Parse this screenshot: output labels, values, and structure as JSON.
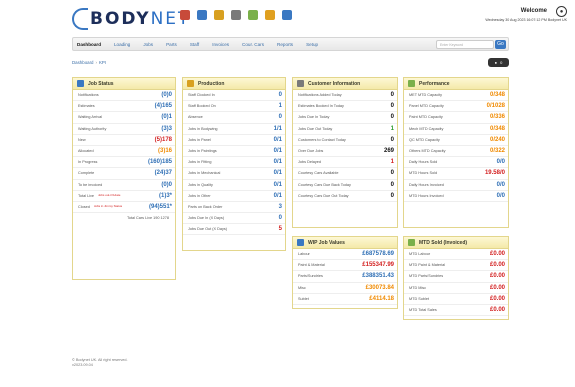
{
  "header": {
    "logo_main": "BODY",
    "logo_accent": "NET",
    "welcome": "Welcome",
    "datetime": "Wednesday 30 Aug 2023 16:07:12 PM  Bodynet UK",
    "icons": [
      "cars-icon",
      "calculator-icon",
      "calendar-icon",
      "tools-icon",
      "paint-icon",
      "star-icon",
      "settings-icon"
    ],
    "icon_colors": [
      "#c84a3a",
      "#3a78c2",
      "#d8a020",
      "#7a7a7a",
      "#7ab04a",
      "#e0a020",
      "#3a78c2"
    ]
  },
  "nav": {
    "items": [
      "Dashboard",
      "Loading",
      "Jobs",
      "Parts",
      "Staff",
      "Invoices",
      "Cour. Cars",
      "Reports",
      "Setup"
    ],
    "search_placeholder": "Enter Keyword",
    "search_btn": "Go"
  },
  "breadcrumb": {
    "home": "Dashboard",
    "current": "KPI",
    "badge": "0"
  },
  "job_status": {
    "title": "Job Status",
    "rows": [
      {
        "label": "Notifications",
        "value": "(0)0",
        "color": "blue"
      },
      {
        "label": "Estimates",
        "value": "(4)165",
        "color": "blue"
      },
      {
        "label": "Waiting Arrival",
        "value": "(0)1",
        "color": "blue"
      },
      {
        "label": "Waiting Authority",
        "value": "(3)3",
        "color": "blue"
      },
      {
        "label": "New",
        "value": "(5)178",
        "color": "red"
      },
      {
        "label": "Allocated",
        "value": "(3)16",
        "color": "orange"
      },
      {
        "label": "In Progress",
        "value": "(160)185",
        "color": "blue"
      },
      {
        "label": "Complete",
        "value": "(24)37",
        "color": "blue"
      },
      {
        "label": "To be invoiced",
        "value": "(0)0",
        "color": "blue"
      },
      {
        "label": "Total Live",
        "note": "Jobs out-Of-date",
        "value": "(1)3*",
        "color": "blue"
      },
      {
        "label": "Closed",
        "note": "Jobs in Jimmy Status",
        "value": "(94)551*",
        "color": "blue"
      }
    ],
    "total_line": "Total Cars Live 190 1278"
  },
  "production": {
    "title": "Production",
    "rows": [
      {
        "label": "Staff Clocked In",
        "value": "0",
        "color": "blue"
      },
      {
        "label": "Staff Booked On",
        "value": "1",
        "color": "blue"
      },
      {
        "label": "Absence",
        "value": "0",
        "color": "blue"
      },
      {
        "label": "Jobs in Bodywing",
        "value": "1/1",
        "color": "blue"
      },
      {
        "label": "Jobs in Panel",
        "value": "0/1",
        "color": "blue"
      },
      {
        "label": "Jobs in Paintings",
        "value": "0/1",
        "color": "blue"
      },
      {
        "label": "Jobs in Fitting",
        "value": "0/1",
        "color": "blue"
      },
      {
        "label": "Jobs in Mechanical",
        "value": "0/1",
        "color": "blue"
      },
      {
        "label": "Jobs in Quality",
        "value": "0/1",
        "color": "blue"
      },
      {
        "label": "Jobs in Other",
        "value": "0/1",
        "color": "blue"
      },
      {
        "label": "Parts on Back Order",
        "value": "3",
        "color": "blue"
      },
      {
        "label": "Jobs Due In (X Days)",
        "value": "0",
        "color": "blue"
      },
      {
        "label": "Jobs Due Out (X Days)",
        "value": "5",
        "color": "red"
      }
    ]
  },
  "customer": {
    "title": "Customer Information",
    "rows": [
      {
        "label": "Notifications Added Today",
        "value": "0",
        "color": "dark"
      },
      {
        "label": "Estimates Booked In Today",
        "value": "0",
        "color": "dark"
      },
      {
        "label": "Jobs Due In Today",
        "value": "0",
        "color": "dark"
      },
      {
        "label": "Jobs Due Out Today",
        "value": "1",
        "color": "green"
      },
      {
        "label": "Customers to Contact Today",
        "value": "0",
        "color": "dark"
      },
      {
        "label": "Over Due Jobs",
        "value": "269",
        "color": "dark"
      },
      {
        "label": "Jobs Delayed",
        "value": "1",
        "color": "red"
      },
      {
        "label": "Courtesy Cars Available",
        "value": "0",
        "color": "dark"
      },
      {
        "label": "Courtesy Cars Due Back Today",
        "value": "0",
        "color": "dark"
      },
      {
        "label": "Courtesy Cars Due Out Today",
        "value": "0",
        "color": "dark"
      }
    ]
  },
  "performance": {
    "title": "Performance",
    "rows": [
      {
        "label": "MET MTD Capacity",
        "value": "0/348",
        "color": "orange"
      },
      {
        "label": "Panel MTD Capacity",
        "value": "0/1028",
        "color": "orange"
      },
      {
        "label": "Paint MTD Capacity",
        "value": "0/336",
        "color": "orange"
      },
      {
        "label": "Mech MTD Capacity",
        "value": "0/348",
        "color": "orange"
      },
      {
        "label": "QC MTD Capacity",
        "value": "0/240",
        "color": "orange"
      },
      {
        "label": "Others MTD Capacity",
        "value": "0/322",
        "color": "orange"
      },
      {
        "label": "Daily Hours Sold",
        "value": "0/0",
        "color": "blue"
      },
      {
        "label": "MTD Hours Sold",
        "value": "19.58/0",
        "color": "red"
      },
      {
        "label": "Daily Hours Invoiced",
        "value": "0/0",
        "color": "blue"
      },
      {
        "label": "MTD Hours Invoiced",
        "value": "0/0",
        "color": "blue"
      }
    ]
  },
  "wip": {
    "title": "WIP Job Values",
    "rows": [
      {
        "label": "Labour",
        "value": "£687578.69",
        "color": "blue"
      },
      {
        "label": "Paint & Material",
        "value": "£155347.99",
        "color": "red"
      },
      {
        "label": "Parts/Sundries",
        "value": "£388351.43",
        "color": "blue"
      },
      {
        "label": "Misc",
        "value": "£30073.84",
        "color": "orange"
      },
      {
        "label": "Sublet",
        "value": "£4114.18",
        "color": "orange"
      }
    ]
  },
  "mtd": {
    "title": "MTD Sold (Invoiced)",
    "rows": [
      {
        "label": "MTD Labour",
        "value": "£0.00",
        "color": "red"
      },
      {
        "label": "MTD Paint & Material",
        "value": "£0.00",
        "color": "red"
      },
      {
        "label": "MTD Parts/Sundries",
        "value": "£0.00",
        "color": "red"
      },
      {
        "label": "MTD Misc",
        "value": "£0.00",
        "color": "red"
      },
      {
        "label": "MTD Sublet",
        "value": "£0.00",
        "color": "red"
      },
      {
        "label": "MTD Total Sales",
        "value": "£0.00",
        "color": "red"
      }
    ]
  },
  "footer": {
    "line1": "© Bodynet UK. All right reserved.",
    "line2": "v2023.09.04"
  }
}
